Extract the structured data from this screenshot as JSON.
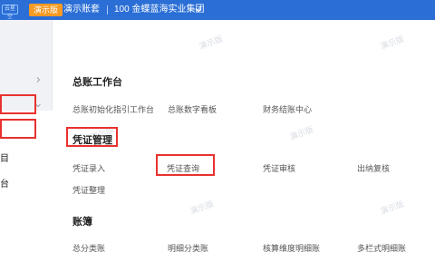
{
  "header": {
    "logo_badge": "云星空",
    "demo_label": "演示版",
    "account_label": "演示账套",
    "org_label": "100 金蝶蓝海实业集团"
  },
  "sidebar": {
    "chars": [
      "目",
      "台"
    ]
  },
  "watermark": "演示版",
  "sections": [
    {
      "title": "总账工作台",
      "items": [
        "总账初始化指引工作台",
        "总账数字看板",
        "财务结账中心"
      ]
    },
    {
      "title": "凭证管理",
      "items": [
        "凭证录入",
        "凭证查询",
        "凭证审核",
        "出纳复核",
        "凭证整理"
      ]
    },
    {
      "title": "账簿",
      "items": [
        "总分类账",
        "明细分类账",
        "核算维度明细账",
        "多栏式明细账"
      ]
    }
  ],
  "colors": {
    "header_bg": "#2b6fd6",
    "demo_tag": "#f59a23",
    "highlight": "#e8322f"
  }
}
